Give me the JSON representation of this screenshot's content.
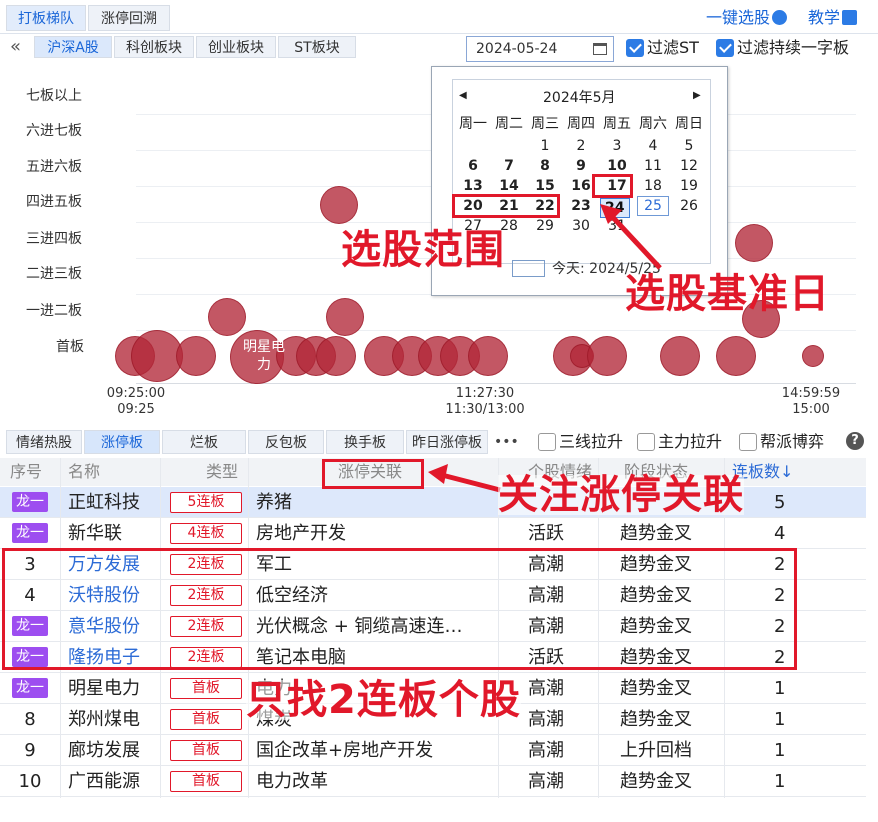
{
  "top_tabs": [
    "打板梯队",
    "涨停回溯"
  ],
  "top_links": {
    "select": "一键选股",
    "teach": "教学"
  },
  "market_tabs": [
    "沪深A股",
    "科创板块",
    "创业板块",
    "ST板块"
  ],
  "date_value": "2024-05-24",
  "filters": {
    "st": "过滤ST",
    "one": "过滤持续一字板"
  },
  "y_levels": [
    "七板以上",
    "六进七板",
    "五进六板",
    "四进五板",
    "三进四板",
    "二进三板",
    "一进二板",
    "首板"
  ],
  "x_ticks": [
    {
      "top": "09:25:00",
      "bottom": "09:25"
    },
    {
      "top": "11:27:30",
      "bottom": "11:30/13:00"
    },
    {
      "top": "14:59:59",
      "bottom": "15:00"
    }
  ],
  "bubble_labels": [
    "明星电",
    "力"
  ],
  "calendar": {
    "title": "2024年5月",
    "weekdays": [
      "周一",
      "周二",
      "周三",
      "周四",
      "周五",
      "周六",
      "周日"
    ],
    "days": [
      "1",
      "2",
      "3",
      "4",
      "5",
      "6",
      "7",
      "8",
      "9",
      "10",
      "11",
      "12",
      "13",
      "14",
      "15",
      "16",
      "17",
      "18",
      "19",
      "20",
      "21",
      "22",
      "23",
      "24",
      "25",
      "26",
      "27",
      "28",
      "29",
      "30",
      "31"
    ],
    "today": "今天: 2024/5/25"
  },
  "annotations": {
    "range": "选股范围",
    "base_day": "选股基准日",
    "focus": "关注涨停关联",
    "find": "只找2连板个股"
  },
  "sub_tabs": [
    "情绪热股",
    "涨停板",
    "烂板",
    "反包板",
    "换手板",
    "昨日涨停板"
  ],
  "more": "•••",
  "options": [
    "三线拉升",
    "主力拉升",
    "帮派博弈"
  ],
  "help": "?",
  "columns": [
    "序号",
    "名称",
    "类型",
    "涨停关联",
    "个股情绪",
    "阶段状态",
    "连板数↓"
  ],
  "rows": [
    {
      "no": "龙一",
      "name": "正虹科技",
      "type": "5连板",
      "rel": "养猪",
      "mood": "",
      "stage": "",
      "count": "5"
    },
    {
      "no": "龙一",
      "name": "新华联",
      "type": "4连板",
      "rel": "房地产开发",
      "mood": "活跃",
      "stage": "趋势金叉",
      "count": "4"
    },
    {
      "no": "3",
      "name": "万方发展",
      "type": "2连板",
      "rel": "军工",
      "mood": "高潮",
      "stage": "趋势金叉",
      "count": "2"
    },
    {
      "no": "4",
      "name": "沃特股份",
      "type": "2连板",
      "rel": "低空经济",
      "mood": "高潮",
      "stage": "趋势金叉",
      "count": "2"
    },
    {
      "no": "龙一",
      "name": "意华股份",
      "type": "2连板",
      "rel": "光伏概念 + 铜缆高速连…",
      "mood": "高潮",
      "stage": "趋势金叉",
      "count": "2"
    },
    {
      "no": "龙一",
      "name": "隆扬电子",
      "type": "2连板",
      "rel": "笔记本电脑",
      "mood": "活跃",
      "stage": "趋势金叉",
      "count": "2"
    },
    {
      "no": "龙一",
      "name": "明星电力",
      "type": "首板",
      "rel": "电力",
      "mood": "高潮",
      "stage": "趋势金叉",
      "count": "1"
    },
    {
      "no": "8",
      "name": "郑州煤电",
      "type": "首板",
      "rel": "煤炭",
      "mood": "高潮",
      "stage": "趋势金叉",
      "count": "1"
    },
    {
      "no": "9",
      "name": "廊坊发展",
      "type": "首板",
      "rel": "国企改革+房地产开发",
      "mood": "高潮",
      "stage": "上升回档",
      "count": "1"
    },
    {
      "no": "10",
      "name": "广西能源",
      "type": "首板",
      "rel": "电力改革",
      "mood": "高潮",
      "stage": "趋势金叉",
      "count": "1"
    }
  ],
  "colors": {
    "accent": "#1a66d8",
    "highlight": "#e1182a",
    "badge": "#9d4ef0",
    "bubble": "#b22838"
  }
}
